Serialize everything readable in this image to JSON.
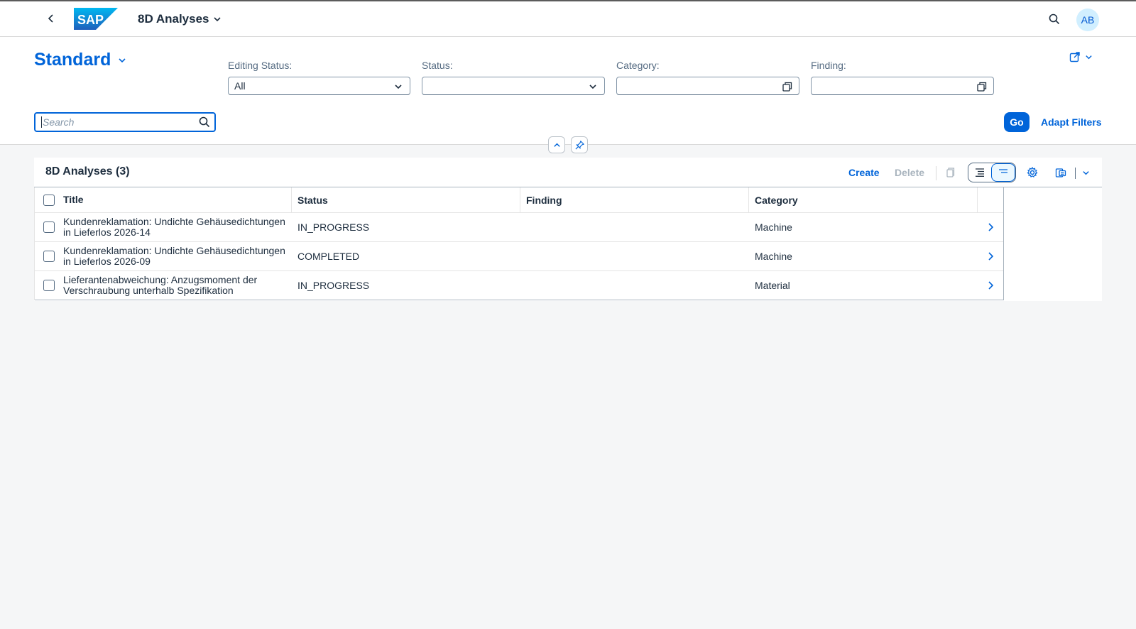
{
  "shell": {
    "logo_text": "SAP",
    "app_title": "8D Analyses",
    "avatar_initials": "AB"
  },
  "header": {
    "variant_name": "Standard"
  },
  "filters": {
    "search_placeholder": "Search",
    "editing_status": {
      "label": "Editing Status:",
      "value": "All"
    },
    "status": {
      "label": "Status:",
      "value": ""
    },
    "category": {
      "label": "Category:",
      "value": ""
    },
    "finding": {
      "label": "Finding:",
      "value": ""
    },
    "go_label": "Go",
    "adapt_label": "Adapt Filters"
  },
  "table": {
    "title": "8D Analyses (3)",
    "create_label": "Create",
    "delete_label": "Delete",
    "columns": [
      "Title",
      "Status",
      "Finding",
      "Category"
    ],
    "rows": [
      {
        "title": "Kundenreklamation: Undichte Gehäusedichtungen in Lieferlos 2026-14",
        "status": "IN_PROGRESS",
        "finding": "",
        "category": "Machine"
      },
      {
        "title": "Kundenreklamation: Undichte Gehäusedichtungen in Lieferlos 2026-09",
        "status": "COMPLETED",
        "finding": "",
        "category": "Machine"
      },
      {
        "title": "Lieferantenabweichung: Anzugsmoment der Verschraubung unterhalb Spezifikation",
        "status": "IN_PROGRESS",
        "finding": "",
        "category": "Material"
      }
    ]
  },
  "colors": {
    "brand": "#0064d9",
    "background": "#f5f6f7"
  }
}
